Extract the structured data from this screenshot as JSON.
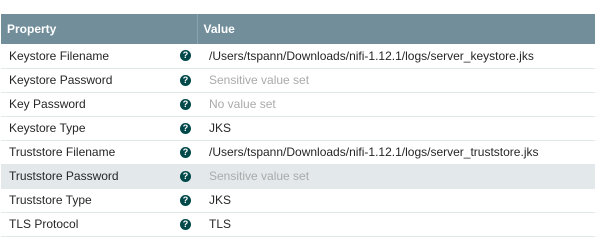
{
  "table": {
    "headers": {
      "property": "Property",
      "value": "Value"
    },
    "help_icon": "question-circle-icon",
    "rows": [
      {
        "property": "Keystore Filename",
        "value": "/Users/tspann/Downloads/nifi-1.12.1/logs/server_keystore.jks",
        "muted": false
      },
      {
        "property": "Keystore Password",
        "value": "Sensitive value set",
        "muted": true
      },
      {
        "property": "Key Password",
        "value": "No value set",
        "muted": true
      },
      {
        "property": "Keystore Type",
        "value": "JKS",
        "muted": false
      },
      {
        "property": "Truststore Filename",
        "value": "/Users/tspann/Downloads/nifi-1.12.1/logs/server_truststore.jks",
        "muted": false
      },
      {
        "property": "Truststore Password",
        "value": "Sensitive value set",
        "muted": true,
        "highlighted": true
      },
      {
        "property": "Truststore Type",
        "value": "JKS",
        "muted": false
      },
      {
        "property": "TLS Protocol",
        "value": "TLS",
        "muted": false
      }
    ]
  },
  "colors": {
    "header_bg": "#728e9b",
    "help_icon": "#004849",
    "highlight_row": "#e3e8eb",
    "muted_text": "#aaaaaa"
  }
}
